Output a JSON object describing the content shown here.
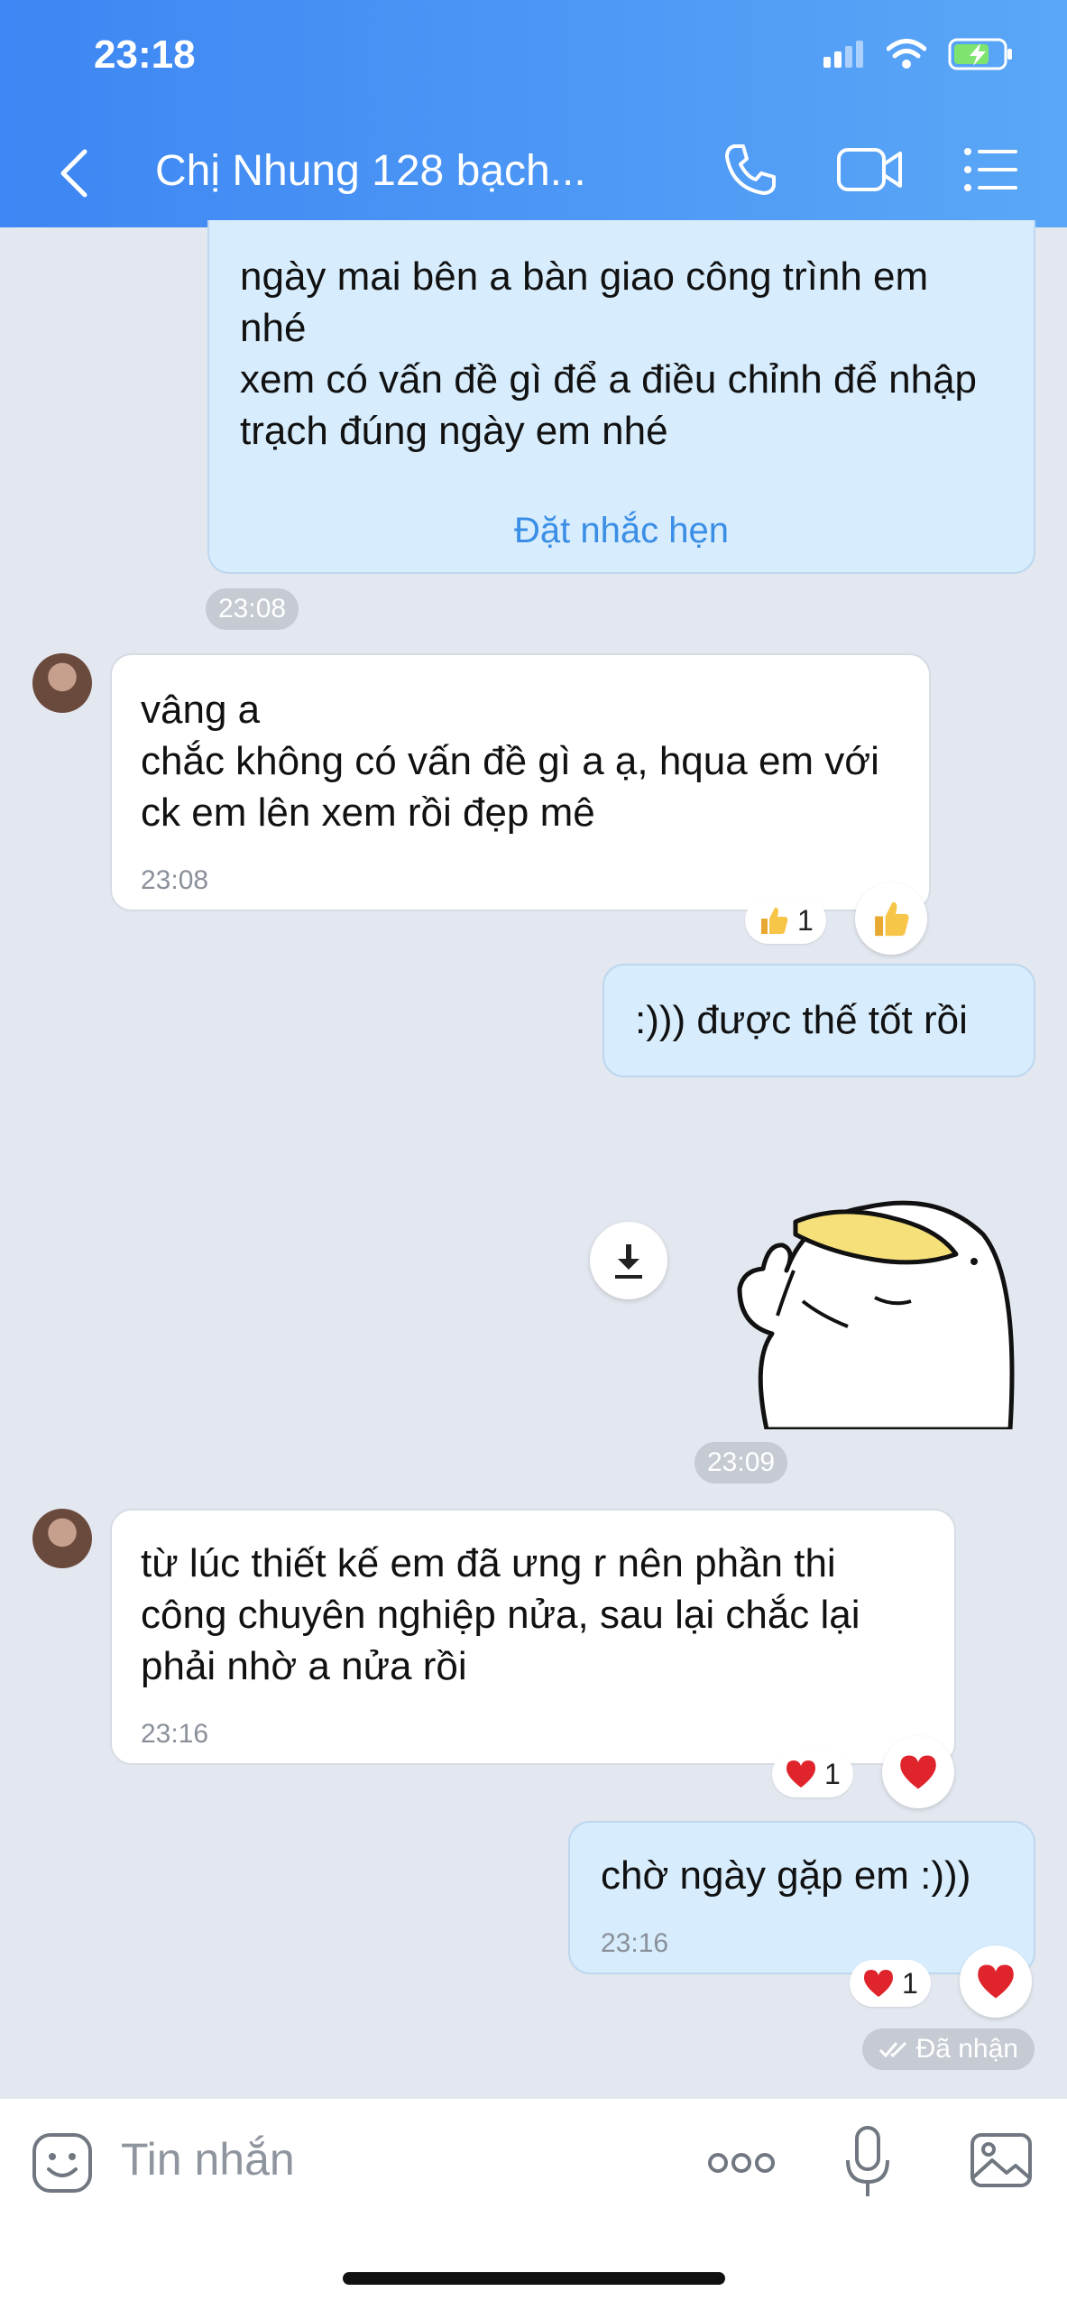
{
  "status_bar": {
    "time": "23:18"
  },
  "header": {
    "title": "Chị Nhung 128 bạch..."
  },
  "messages": [
    {
      "text": "ngày mai bên a bàn giao công trình em nhé\nxem có vấn đề gì để a điều chỉnh để nhập trạch đúng ngày em nhé",
      "action": "Đặt nhắc hẹn"
    },
    {
      "text": "vâng a\n chắc không có vấn đề gì a ạ, hqua em với ck em lên xem rồi đẹp mê",
      "time": "23:08",
      "reaction_count": "1"
    },
    {
      "text": ":))) được thế tốt rồi"
    },
    {
      "text": "từ lúc thiết kế em đã ưng r nên phần thi công chuyên nghiệp nửa, sau lại chắc lại phải nhờ a nửa rồi",
      "time": "23:16",
      "reaction_count": "1"
    },
    {
      "text": "chờ ngày gặp em :)))",
      "time": "23:16",
      "reaction_count": "1"
    }
  ],
  "time_pills": [
    "23:08",
    "23:09"
  ],
  "delivery_status": "Đã nhận",
  "input": {
    "placeholder": "Tin nhắn"
  },
  "colors": {
    "header_start": "#3d86f3",
    "header_end": "#5aa7f7",
    "outgoing_bubble": "#d7ecfc",
    "incoming_bubble": "#ffffff",
    "background": "#e3e7ef",
    "link": "#3a8ee6"
  },
  "icons": [
    "back-icon",
    "phone-icon",
    "video-call-icon",
    "menu-list-icon",
    "download-icon",
    "sticker-duck",
    "emoji-icon",
    "more-icon",
    "microphone-icon",
    "image-icon",
    "thumbs-up-icon",
    "heart-icon",
    "double-check-icon",
    "signal-icon",
    "wifi-icon",
    "battery-icon"
  ]
}
